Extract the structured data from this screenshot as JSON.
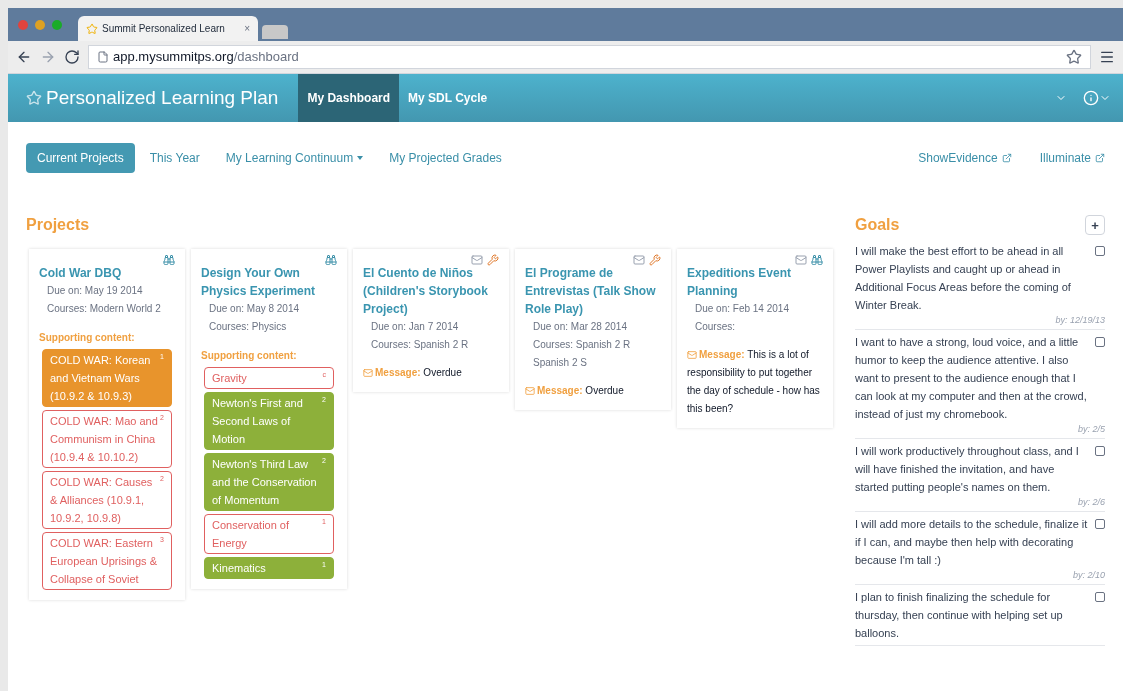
{
  "browser": {
    "tab_title": "Summit Personalized Learn",
    "tab_close": "×",
    "url_host": "app.mysummitps.org",
    "url_path": "/dashboard"
  },
  "navbar": {
    "brand": "Personalized Learning Plan",
    "items": [
      {
        "label": "My Dashboard",
        "selected": true
      },
      {
        "label": "My SDL Cycle",
        "selected": false
      }
    ]
  },
  "subnav": {
    "items": [
      {
        "label": "Current Projects",
        "selected": true,
        "dropdown": false
      },
      {
        "label": "This Year",
        "selected": false,
        "dropdown": false
      },
      {
        "label": "My Learning Continuum",
        "selected": false,
        "dropdown": true
      },
      {
        "label": "My Projected Grades",
        "selected": false,
        "dropdown": false
      }
    ],
    "links": [
      "ShowEvidence",
      "Illuminate"
    ]
  },
  "projects": {
    "title": "Projects",
    "cards": [
      {
        "title": "Cold War DBQ",
        "icons": [
          {
            "kind": "binoculars"
          }
        ],
        "due": "Due on: May 19 2014",
        "courses": "Courses: Modern World 2",
        "supporting_title": "Supporting content:",
        "supporting": [
          {
            "label": "COLD WAR: Korean and Vietnam Wars (10.9.2 & 10.9.3)",
            "count": "1",
            "filled": true,
            "color": "#e8942c"
          },
          {
            "label": "COLD WAR: Mao and Communism in China (10.9.4 & 10.10.2)",
            "count": "2",
            "filled": false,
            "color": "#e06060"
          },
          {
            "label": "COLD WAR: Causes & Alliances (10.9.1, 10.9.2, 10.9.8)",
            "count": "2",
            "filled": false,
            "color": "#e06060"
          },
          {
            "label": "COLD WAR: Eastern European Uprisings & Collapse of Soviet",
            "count": "3",
            "filled": false,
            "color": "#e06060"
          }
        ]
      },
      {
        "title": "Design Your Own Physics Experiment",
        "icons": [
          {
            "kind": "binoculars"
          }
        ],
        "due": "Due on: May 8 2014",
        "courses": "Courses: Physics",
        "supporting_title": "Supporting content:",
        "supporting": [
          {
            "label": "Gravity",
            "count": "c",
            "filled": false,
            "color": "#e06060"
          },
          {
            "label": "Newton's First and Second Laws of Motion",
            "count": "2",
            "filled": true,
            "color": "#8db03a"
          },
          {
            "label": "Newton's Third Law and the Conservation of Momentum",
            "count": "2",
            "filled": true,
            "color": "#8db03a"
          },
          {
            "label": "Conservation of Energy",
            "count": "1",
            "filled": false,
            "color": "#e06060"
          },
          {
            "label": "Kinematics",
            "count": "1",
            "filled": true,
            "color": "#8db03a"
          }
        ]
      },
      {
        "title": "El Cuento de Niños (Children's Storybook Project)",
        "icons": [
          {
            "kind": "envelope"
          },
          {
            "kind": "wrench"
          }
        ],
        "due": "Due on: Jan 7 2014",
        "courses": "Courses: Spanish 2 R",
        "message_label": "Message:",
        "message": "Overdue"
      },
      {
        "title": "El Programe de Entrevistas (Talk Show Role Play)",
        "icons": [
          {
            "kind": "envelope"
          },
          {
            "kind": "wrench"
          }
        ],
        "due": "Due on: Mar 28 2014",
        "courses": "Courses: Spanish 2 R Spanish 2 S",
        "message_label": "Message:",
        "message": "Overdue"
      },
      {
        "title": "Expeditions Event Planning",
        "icons": [
          {
            "kind": "envelope"
          },
          {
            "kind": "binoculars"
          }
        ],
        "due": "Due on: Feb 14 2014",
        "courses": "Courses:",
        "message_label": "Message:",
        "message": "This is a lot of responsibility to put together the day of schedule - how has this been?"
      }
    ]
  },
  "goals": {
    "title": "Goals",
    "add": "+",
    "items": [
      {
        "text": "I will make the best effort to be ahead in all Power Playlists and caught up or ahead in Additional Focus Areas before the coming of Winter Break.",
        "by": "by: 12/19/13",
        "checked": false
      },
      {
        "text": "I want to have a strong, loud voice, and a little humor to keep the audience attentive. I also want to present to the audience enough that I can look at my computer and then at the crowd, instead of just my chromebook.",
        "by": "by: 2/5",
        "checked": false
      },
      {
        "text": "I will work productively throughout class, and I will have finished the invitation, and have started putting people's names on them.",
        "by": "by: 2/6",
        "checked": false
      },
      {
        "text": "I will add more details to the schedule, finalize it if I can, and maybe then help with decorating because I'm tall :)",
        "by": "by: 2/10",
        "checked": false
      },
      {
        "text": "I plan to finish finalizing the schedule for thursday, then continue with helping set up balloons.",
        "checked": false
      }
    ]
  }
}
